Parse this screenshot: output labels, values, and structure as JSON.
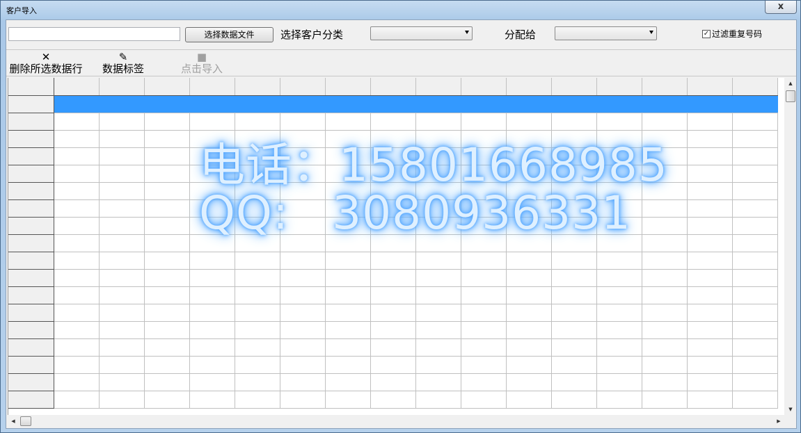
{
  "window": {
    "title": "客户导入",
    "close_label": "x"
  },
  "toolbar1": {
    "file_input_value": "",
    "choose_file_label": "选择数据文件",
    "category_label": "选择客户分类",
    "category_value": "",
    "assign_label": "分配给",
    "assign_value": "",
    "filter_dup_label": "过滤重复号码",
    "filter_dup_checked": "✓"
  },
  "toolbar2": {
    "delete_icon": "✕",
    "delete_label": "删除所选数据行",
    "tag_icon": "✎",
    "tag_label": "数据标签",
    "import_icon": "■",
    "import_label": "点击导入"
  },
  "grid": {
    "columns": 16,
    "rows": 18,
    "selected_row": 1
  },
  "watermark": {
    "line1": "电话：15801668985",
    "line2_label": "QQ:",
    "line2_value": "3080936331"
  }
}
